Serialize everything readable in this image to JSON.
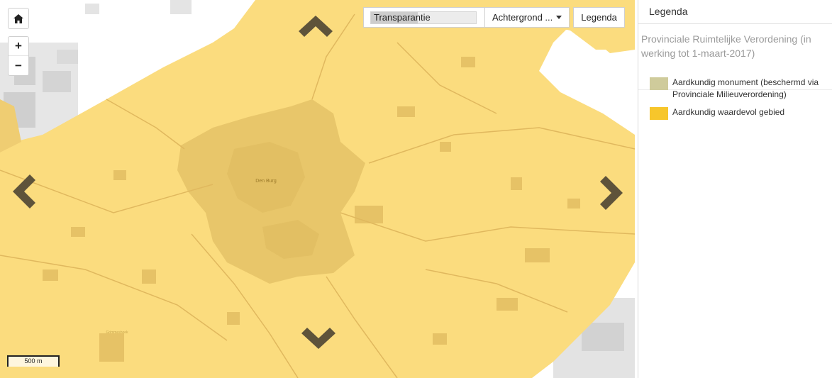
{
  "map": {
    "place_label": "Den Burg",
    "faint_label": "Grimmeshoek",
    "colors": {
      "land": "#fbdc7e",
      "town": "#e9c76a",
      "blocks": "#e3c064",
      "roads": "#e0b85e",
      "outside": "#ffffff",
      "urban_gray": "#d8d8d8"
    }
  },
  "controls": {
    "home_icon": "home-icon",
    "zoom_in": "+",
    "zoom_out": "−"
  },
  "toolbar": {
    "transparency_label": "Transparantie",
    "background_label": "Achtergrond ...",
    "legend_label": "Legenda"
  },
  "scale": {
    "label": "500 m"
  },
  "legend": {
    "title": "Legenda",
    "subtitle": "Provinciale Ruimtelijke Verordening (in werking tot 1-maart-2017)",
    "items": [
      {
        "label": "Aardkundig monument (beschermd via Provinciale Milieuverordening)",
        "color": "#cfcb9b"
      },
      {
        "label": "Aardkundig waardevol gebied",
        "color": "#f7c62b"
      }
    ]
  }
}
